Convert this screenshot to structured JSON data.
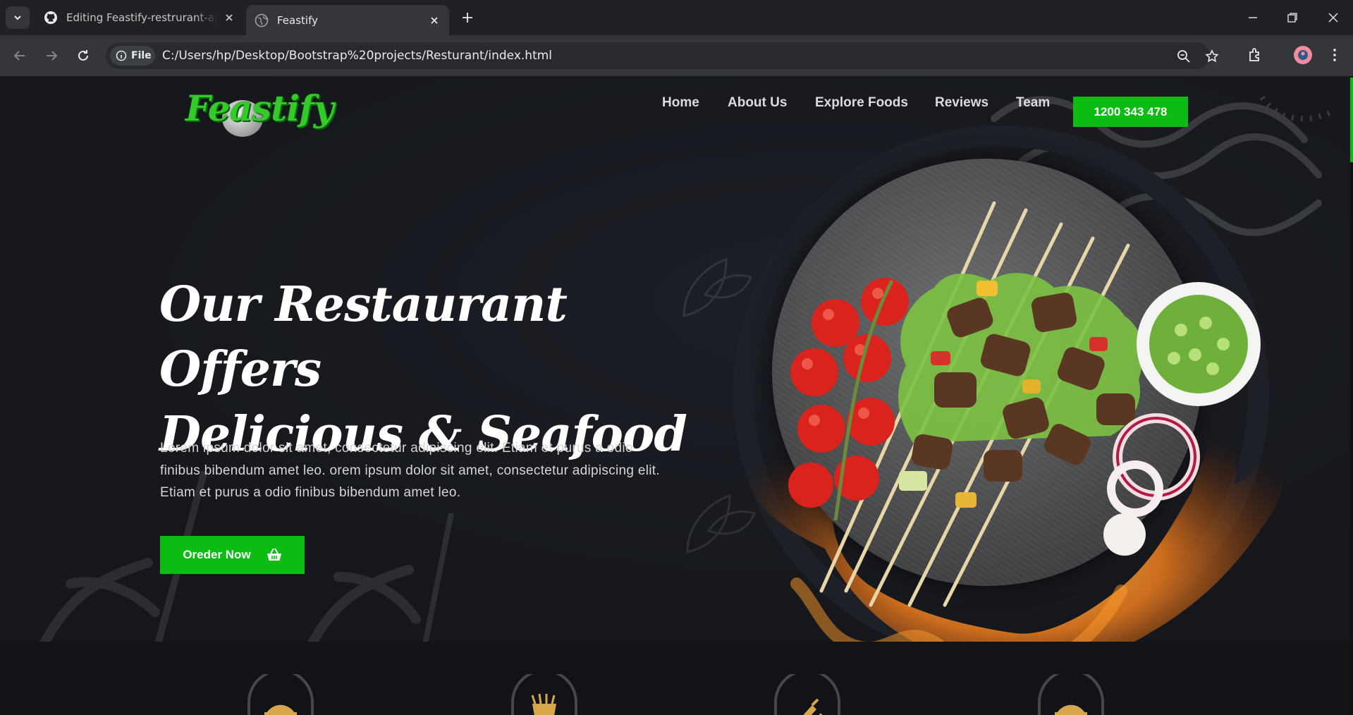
{
  "browser": {
    "tabs": [
      {
        "title": "Editing Feastify-restrurant-appl",
        "favicon": "github-icon",
        "active": false
      },
      {
        "title": "Feastify",
        "favicon": "globe-icon",
        "active": true
      }
    ],
    "address": {
      "scheme_label": "File",
      "url": "C:/Users/hp/Desktop/Bootstrap%20projects/Resturant/index.html"
    }
  },
  "site": {
    "logo_text": "Feastify",
    "nav": [
      "Home",
      "About Us",
      "Explore Foods",
      "Reviews",
      "Team"
    ],
    "phone_button": "1200 343 478",
    "hero": {
      "headline_line1": "Our Restaurant Offers",
      "headline_line2": "Delicious & Seafood",
      "paragraph": "Lorem ipsum dolor sit amet, consectetur adipiscing elit. Etiam et purus a odio finibus bibendum amet leo. orem ipsum dolor sit amet, consectetur adipiscing elit. Etiam et purus a odio finibus bibendum amet leo.",
      "order_button": "Oreder Now"
    }
  },
  "colors": {
    "accent": "#0bbd12",
    "background": "#15171c",
    "logo_green": "#36c92c",
    "badge_gold": "#d8a64a"
  }
}
